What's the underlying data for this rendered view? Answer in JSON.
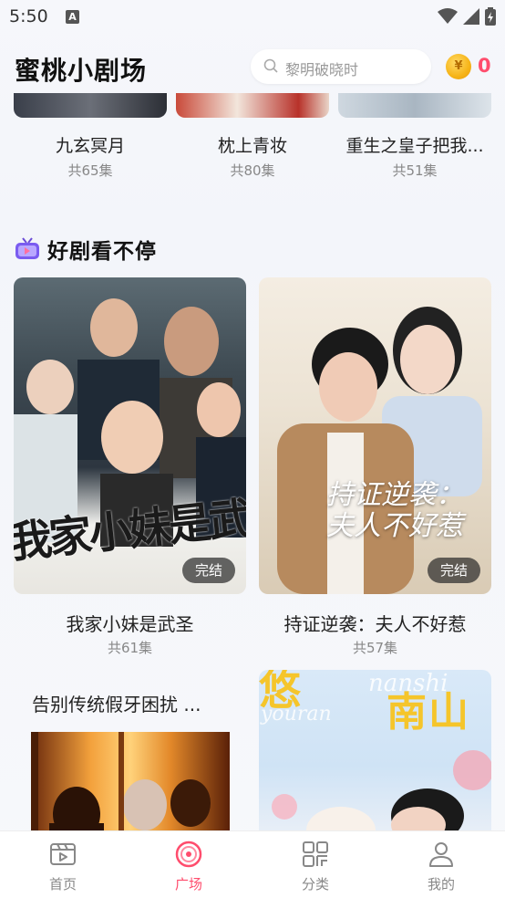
{
  "status_bar": {
    "time": "5:50",
    "notif_letter": "A"
  },
  "header": {
    "title": "蜜桃小剧场",
    "search_placeholder": "黎明破晓时",
    "coins": "0"
  },
  "top_row": [
    {
      "title": "九玄冥月",
      "episodes": "共65集"
    },
    {
      "title": "枕上青妆",
      "episodes": "共80集"
    },
    {
      "title": "重生之皇子把我...",
      "episodes": "共51集"
    }
  ],
  "section": {
    "title": "好剧看不停"
  },
  "dramas": [
    {
      "title": "我家小妹是武圣",
      "episodes": "共61集",
      "badge": "完结",
      "poster_text": "我家小妹是武圣"
    },
    {
      "title": "持证逆袭：夫人不好惹",
      "episodes": "共57集",
      "badge": "完结",
      "poster_text_1": "持证逆袭：",
      "poster_text_2": "夫人不好惹"
    }
  ],
  "ad": {
    "title": "告别传统假牙困扰 ..."
  },
  "partial_poster": {
    "text_1": "悠",
    "text_2": "南山",
    "script_text": "nanshi",
    "script_text_2": "youran"
  },
  "bottom_nav": [
    {
      "label": "首页",
      "icon": "play-video-icon",
      "active": false
    },
    {
      "label": "广场",
      "icon": "disc-icon",
      "active": true
    },
    {
      "label": "分类",
      "icon": "grid-category-icon",
      "active": false
    },
    {
      "label": "我的",
      "icon": "user-icon",
      "active": false
    }
  ],
  "colors": {
    "accent": "#ff4d6d",
    "coin": "#f6b417"
  }
}
